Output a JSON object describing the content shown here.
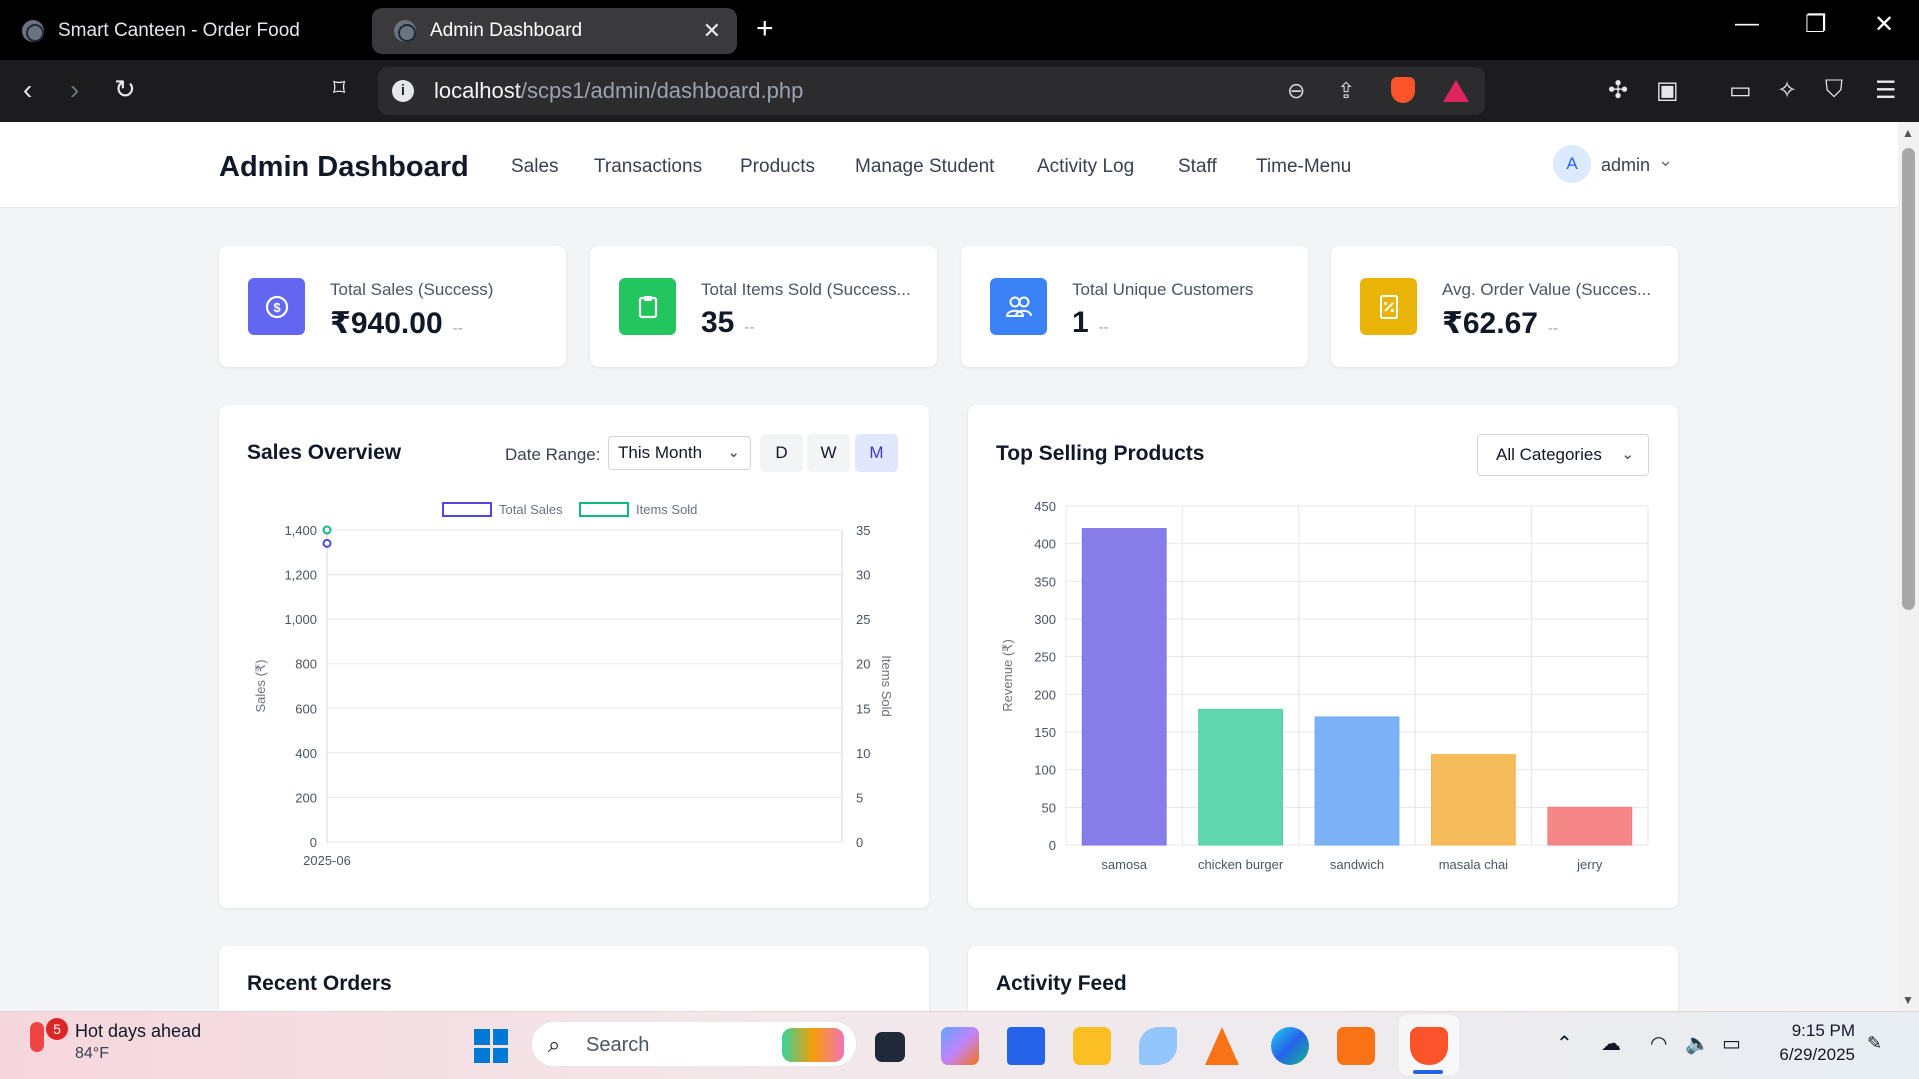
{
  "browser": {
    "tabs": [
      {
        "title": "Smart Canteen - Order Food",
        "active": false
      },
      {
        "title": "Admin Dashboard",
        "active": true
      }
    ],
    "url_host": "localhost",
    "url_path": "/scps1/admin/dashboard.php"
  },
  "header": {
    "title": "Admin Dashboard",
    "nav": [
      "Sales",
      "Transactions",
      "Products",
      "Manage Student",
      "Activity Log",
      "Staff",
      "Time-Menu"
    ],
    "user": {
      "initial": "A",
      "name": "admin"
    }
  },
  "stats": [
    {
      "label": "Total Sales (Success)",
      "value": "₹940.00",
      "delta": "--",
      "color": "#6366f1",
      "icon": "dollar-icon"
    },
    {
      "label": "Total Items Sold (Success...",
      "value": "35",
      "delta": "--",
      "color": "#22c55e",
      "icon": "clipboard-icon"
    },
    {
      "label": "Total Unique Customers",
      "value": "1",
      "delta": "--",
      "color": "#3b82f6",
      "icon": "users-icon"
    },
    {
      "label": "Avg. Order Value (Succes...",
      "value": "₹62.67",
      "delta": "--",
      "color": "#eab308",
      "icon": "receipt-icon"
    }
  ],
  "sales_overview": {
    "title": "Sales Overview",
    "date_range_label": "Date Range:",
    "date_range_value": "This Month",
    "period_buttons": [
      "D",
      "W",
      "M"
    ],
    "active_period": "M"
  },
  "top_products": {
    "title": "Top Selling Products",
    "category_value": "All Categories"
  },
  "bottom": {
    "recent_orders_title": "Recent Orders",
    "activity_feed_title": "Activity Feed"
  },
  "chart_data": [
    {
      "type": "line",
      "x": [
        "2025-06"
      ],
      "series": [
        {
          "name": "Total Sales",
          "axis": "left",
          "values": [
            1340
          ],
          "color": "#4f46e5"
        },
        {
          "name": "Items Sold",
          "axis": "right",
          "values": [
            35
          ],
          "color": "#10b981"
        }
      ],
      "ylabel": "Sales (₹)",
      "y2label": "Items Sold",
      "ylim": [
        0,
        1400
      ],
      "y2lim": [
        0,
        35
      ],
      "yticks": [
        "0",
        "200",
        "400",
        "600",
        "800",
        "1,000",
        "1,200",
        "1,400"
      ],
      "y2ticks": [
        "0",
        "5",
        "10",
        "15",
        "20",
        "25",
        "30",
        "35"
      ],
      "legend": "top",
      "grid": true
    },
    {
      "type": "bar",
      "categories": [
        "samosa",
        "chicken burger",
        "sandwich",
        "masala chai",
        "jerry"
      ],
      "values": [
        420,
        180,
        170,
        120,
        50
      ],
      "colors": [
        "#7c6fe8",
        "#4fd1a5",
        "#6ea8f7",
        "#f5b54a",
        "#f47a7a"
      ],
      "ylabel": "Revenue (₹)",
      "ylim": [
        0,
        450
      ],
      "yticks": [
        "0",
        "50",
        "100",
        "150",
        "200",
        "250",
        "300",
        "350",
        "400",
        "450"
      ],
      "grid": true
    }
  ],
  "taskbar": {
    "weather_badge": "5",
    "weather_title": "Hot days ahead",
    "weather_temp": "84°F",
    "search_placeholder": "Search",
    "time": "9:15 PM",
    "date": "6/29/2025"
  }
}
